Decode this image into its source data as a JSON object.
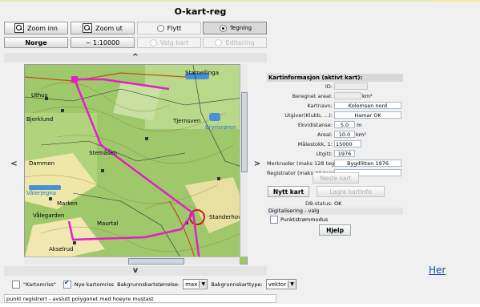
{
  "app": {
    "title": "O-kart-reg"
  },
  "toolbar": {
    "zoom_in": "Zoom inn",
    "zoom_out": "Zoom ut",
    "move": "Flytt",
    "drawing": "Tegning",
    "country": "Norge",
    "scale": "~ 1:10000",
    "choose_map": "Velg kart",
    "editing": "Editering"
  },
  "nav": {
    "up": "^",
    "down": "v",
    "left": "<",
    "right": ">"
  },
  "map": {
    "places": [
      "Starnellinga",
      "Uthus",
      "Bjerklund",
      "Tjernsven",
      "Brynsrøren",
      "Stemåsen",
      "Dammen",
      "Vålerjegna",
      "Marken",
      "Vålegarden",
      "Maurtal",
      "Standerhov",
      "Akselrud"
    ]
  },
  "info": {
    "header": "Kartinformasjon (aktivt kart):",
    "id_label": "ID:",
    "id_value": "",
    "area_calc_label": "Beregnet areal:",
    "area_calc_value": "",
    "area_calc_unit": "km²",
    "map_name_label": "Kartnavn:",
    "map_name_value": "Kolomsen nord",
    "publisher_label": "Utgiver(Klubb, ...):",
    "publisher_value": "Hamar OK",
    "equidistance_label": "Ekvidistanse:",
    "equidistance_value": "5.0",
    "equidistance_unit": "m",
    "area_label": "Areal:",
    "area_value": "10.0",
    "area_unit": "km²",
    "scale_label": "Målestokk, 1:",
    "scale_value": "15000",
    "published_label": "Utgitt:",
    "published_value": "1976",
    "notes_label": "Merknader (maks 128 tegn):",
    "notes_value": "Bygdlitten 1976",
    "registrar_label": "Registrator (maks 40 tegn):",
    "registrar_value": "",
    "next_map": "Neste kart",
    "new_map": "Nytt kart",
    "save_info": "Lagre kartinfo",
    "db_status_label": "DB-status:",
    "db_status_value": "OK",
    "digitizing_label": "Digitalisering - valg",
    "point_mode": "Punktstrømmodus",
    "help": "Hjelp"
  },
  "bottom": {
    "map_frame": "\"Kartomriss\"",
    "new_frames": "Nye kartomriss",
    "bg_size_label": "Bakgrunnskartstørrelse:",
    "bg_size_value": "max",
    "bg_type_label": "Bakgrunnskarttype:",
    "bg_type_value": "vektor"
  },
  "status": "punkt registrert - avslutt polygonet med hoeyre mustast",
  "link": "Her",
  "colors": {
    "route": "#e020c8",
    "map_green": "#9ec86a",
    "accent": "#1a4aa8"
  }
}
